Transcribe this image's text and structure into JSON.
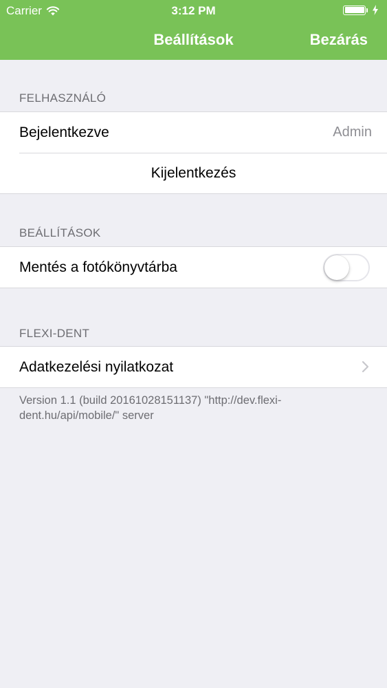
{
  "status_bar": {
    "carrier": "Carrier",
    "time": "3:12 PM",
    "battery_level": 1.0
  },
  "navbar": {
    "title": "Beállítások",
    "close_label": "Bezárás",
    "color": "#79c257"
  },
  "sections": {
    "user": {
      "header": "FELHASZNÁLÓ",
      "logged_in_label": "Bejelentkezve",
      "logged_in_value": "Admin",
      "logout_label": "Kijelentkezés"
    },
    "settings": {
      "header": "BEÁLLÍTÁSOK",
      "save_to_photos_label": "Mentés a fotókönyvtárba",
      "save_to_photos_enabled": false
    },
    "flexi": {
      "header": "FLEXI-DENT",
      "privacy_label": "Adatkezelési nyilatkozat"
    }
  },
  "footer": {
    "version_text": "Version 1.1 (build 20161028151137) \"http://dev.flexi-dent.hu/api/mobile/\" server"
  },
  "icons": [
    "wifi-icon",
    "battery-icon",
    "charging-bolt-icon",
    "chevron-right-icon"
  ]
}
